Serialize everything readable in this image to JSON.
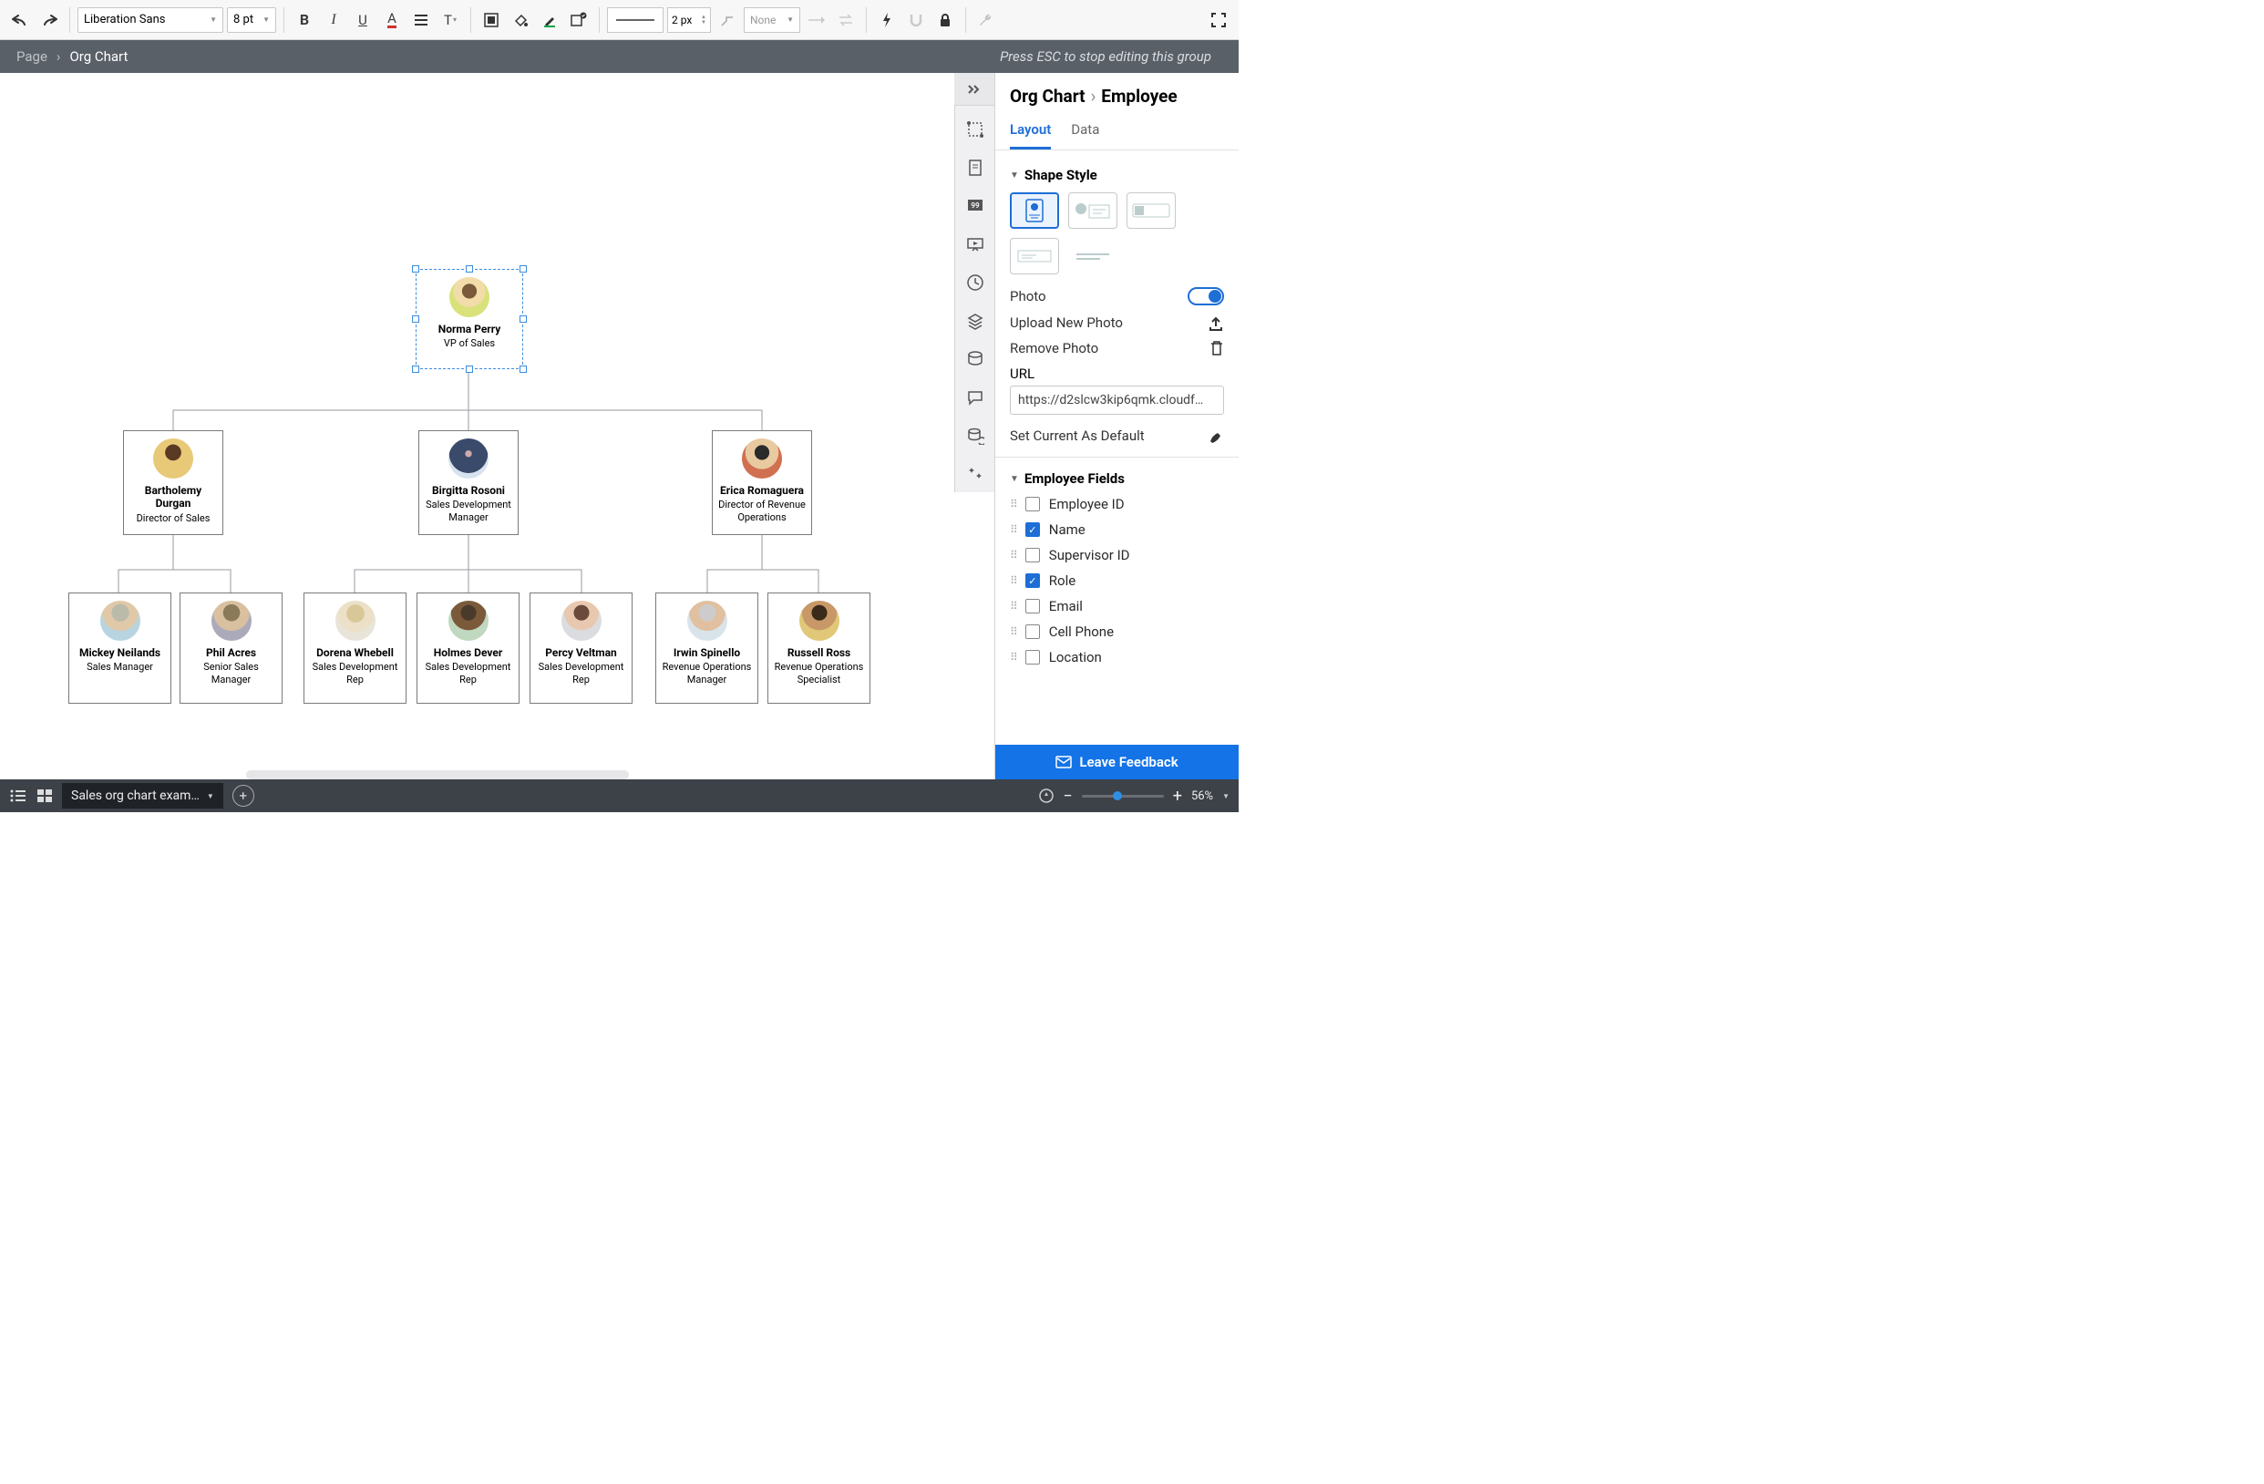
{
  "toolbar": {
    "font": "Liberation Sans",
    "font_size": "8 pt",
    "line_width": "2 px",
    "endpoint": "None"
  },
  "breadcrumb": {
    "page": "Page",
    "group": "Org Chart",
    "hint": "Press ESC to stop editing this group"
  },
  "org": {
    "root": {
      "name": "Norma Perry",
      "role": "VP of Sales"
    },
    "level2": [
      {
        "name": "Bartholemy Durgan",
        "role": "Director of Sales"
      },
      {
        "name": "Birgitta Rosoni",
        "role": "Sales Development Manager"
      },
      {
        "name": "Erica Romaguera",
        "role": "Director of Revenue Operations"
      }
    ],
    "level3": [
      {
        "name": "Mickey Neilands",
        "role": "Sales Manager"
      },
      {
        "name": "Phil Acres",
        "role": "Senior Sales Manager"
      },
      {
        "name": "Dorena Whebell",
        "role": "Sales Development Rep"
      },
      {
        "name": "Holmes Dever",
        "role": "Sales Development Rep"
      },
      {
        "name": "Percy Veltman",
        "role": "Sales Development Rep"
      },
      {
        "name": "Irwin Spinello",
        "role": "Revenue Operations Manager"
      },
      {
        "name": "Russell Ross",
        "role": "Revenue Operations Specialist"
      }
    ]
  },
  "panel": {
    "crumb1": "Org Chart",
    "crumb2": "Employee",
    "tabs": {
      "layout": "Layout",
      "data": "Data"
    },
    "shape_style": "Shape Style",
    "photo": "Photo",
    "upload": "Upload New Photo",
    "remove": "Remove Photo",
    "url_label": "URL",
    "url_value": "https://d2slcw3kip6qmk.cloudf…",
    "set_default": "Set Current As Default",
    "employee_fields": "Employee Fields",
    "fields": [
      {
        "label": "Employee ID",
        "on": false
      },
      {
        "label": "Name",
        "on": true
      },
      {
        "label": "Supervisor ID",
        "on": false
      },
      {
        "label": "Role",
        "on": true
      },
      {
        "label": "Email",
        "on": false
      },
      {
        "label": "Cell Phone",
        "on": false
      },
      {
        "label": "Location",
        "on": false
      }
    ],
    "feedback": "Leave Feedback"
  },
  "bottom": {
    "doc": "Sales org chart exam…",
    "zoom": "56%"
  }
}
